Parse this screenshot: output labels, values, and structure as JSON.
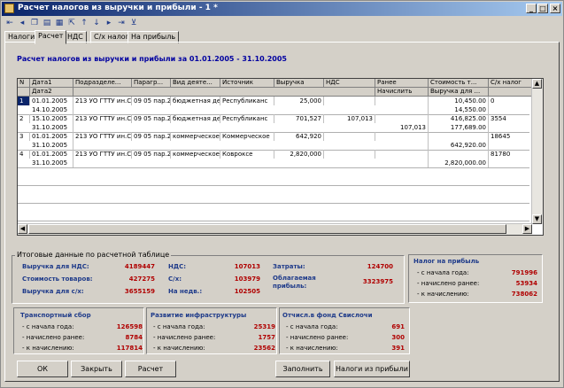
{
  "window": {
    "title": "Расчет налогов из выручки и прибыли - 1 *"
  },
  "toolbar": {
    "icons": [
      "first-icon",
      "prev-icon",
      "copy-icon",
      "save-icon",
      "print-icon",
      "export-icon",
      "up-icon",
      "down-icon",
      "next-icon",
      "last-icon",
      "filter-icon"
    ]
  },
  "tabs": [
    "Налоги",
    "Расчет",
    "НДС",
    "С/х налог",
    "На прибыль"
  ],
  "heading": "Расчет налогов из выручки и прибыли за 01.01.2005 - 31.10.2005",
  "table": {
    "headers1": [
      "N",
      "Дата1",
      "Подразделе...",
      "Парагр...",
      "Вид деяте...",
      "Источник",
      "Выручка",
      "НДС",
      "Ранее",
      "Стоимость т...",
      "С/х налог"
    ],
    "headers2": [
      "Дата2",
      "Начислить",
      "Выручка для ..."
    ],
    "rows": [
      {
        "n": "1",
        "d1": "01.01.2005",
        "d2": "14.10.2005",
        "dept": "213 УО ГТТУ ин.С",
        "par": "09 05 пар.29",
        "vid": "бюджетная де",
        "src": "Республиканс",
        "rev": "25,000",
        "nds": "",
        "prev": "",
        "nach": "",
        "cost": "10,450.00",
        "revf": "14,550.00",
        "sx": "0"
      },
      {
        "n": "2",
        "d1": "15.10.2005",
        "d2": "31.10.2005",
        "dept": "213 УО ГТТУ ин.С",
        "par": "09 05 пар.29",
        "vid": "бюджетная де",
        "src": "Республиканс",
        "rev": "701,527",
        "nds": "107,013",
        "prev": "",
        "nach": "107,013",
        "cost": "416,825.00",
        "revf": "177,689.00",
        "sx": "3554"
      },
      {
        "n": "3",
        "d1": "01.01.2005",
        "d2": "31.10.2005",
        "dept": "213 УО ГТТУ ин.С",
        "par": "09 05 пар.29",
        "vid": "коммерческое",
        "src": "Коммерческое",
        "rev": "642,920",
        "nds": "",
        "prev": "",
        "nach": "",
        "cost": "",
        "revf": "642,920.00",
        "sx": "18645"
      },
      {
        "n": "4",
        "d1": "01.01.2005",
        "d2": "31.10.2005",
        "dept": "213 УО ГТТУ ин.С",
        "par": "09 05 пар.29",
        "vid": "коммерческое",
        "src": "Ковроксе",
        "rev": "2,820,000",
        "nds": "",
        "prev": "",
        "nach": "",
        "cost": "",
        "revf": "2,820,000.00",
        "sx": "81780"
      }
    ]
  },
  "summary": {
    "title": "Итоговые данные по расчетной таблице",
    "rev_nds_label": "Выручка для НДС:",
    "rev_nds": "4189447",
    "cost_label": "Стоимость товаров:",
    "cost": "427275",
    "rev_sx_label": "Выручка для с/х:",
    "rev_sx": "3655159",
    "nds_label": "НДС:",
    "nds": "107013",
    "sx_label": "С/х:",
    "sx": "103979",
    "ned_label": "На недв.:",
    "ned": "102505",
    "zat_label": "Затраты:",
    "zat": "124700",
    "obl_label1": "Облагаемая",
    "obl_label2": "прибыль:",
    "obl": "3323975"
  },
  "profit_tax": {
    "title": "Налог на прибыль",
    "from_start_label": "- с начала года:",
    "from_start": "791996",
    "prev_label": "- начислено ранее:",
    "prev": "53934",
    "charge_label": "- к начислению:",
    "charge": "738062"
  },
  "transport": {
    "title": "Транспортный сбор",
    "from_start_label": "- с начала года:",
    "from_start": "126598",
    "prev_label": "- начислено ранее:",
    "prev": "8784",
    "charge_label": "- к начислению:",
    "charge": "117814"
  },
  "infra": {
    "title": "Развитие инфраструктуры",
    "from_start_label": "- с начала года:",
    "from_start": "25319",
    "prev_label": "- начислено ранее:",
    "prev": "1757",
    "charge_label": "- к начислению:",
    "charge": "23562"
  },
  "svisl": {
    "title": "Отчисл.в фонд Свислочи",
    "from_start_label": "- с начала года:",
    "from_start": "691",
    "prev_label": "- начислено ранее:",
    "prev": "300",
    "charge_label": "- к начислению:",
    "charge": "391"
  },
  "buttons": {
    "ok": "ОК",
    "close": "Закрыть",
    "calc": "Расчет",
    "fill": "Заполнить",
    "taxes": "Налоги из прибыли"
  },
  "colors": {
    "title_bar": "#0a246a",
    "value_red": "#b00000",
    "label_blue": "#1f3b8a",
    "heading_blue": "#0000a0"
  }
}
